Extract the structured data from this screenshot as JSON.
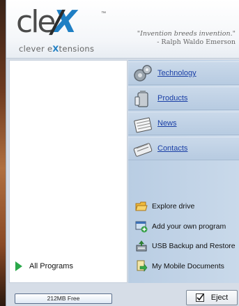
{
  "app": {
    "logo_text": "clevX",
    "logo_tm": "™",
    "logo_subtitle_before": "clever e",
    "logo_subtitle_hi": "X",
    "logo_subtitle_after": "tensions"
  },
  "quote": {
    "text": "\"Invention breeds invention.\"",
    "author": "- Ralph Waldo Emerson"
  },
  "left": {
    "all_programs_label": "All Programs"
  },
  "nav": [
    {
      "label": "Technology",
      "icon": "gears-icon"
    },
    {
      "label": "Products",
      "icon": "products-icon"
    },
    {
      "label": "News",
      "icon": "calendar-icon"
    },
    {
      "label": "Contacts",
      "icon": "handshake-icon"
    }
  ],
  "actions": [
    {
      "label": "Explore drive",
      "icon": "folder-icon"
    },
    {
      "label": "Add your own program",
      "icon": "add-program-icon"
    },
    {
      "label": "USB Backup and Restore",
      "icon": "backup-icon"
    },
    {
      "label": "My Mobile Documents",
      "icon": "mobile-documents-icon"
    }
  ],
  "status": {
    "free_space": "212MB Free",
    "eject_label": "Eject"
  },
  "colors": {
    "accent": "#1f7fc4",
    "link": "#1a3fa6",
    "nav_bg": "#c2d4e7"
  }
}
